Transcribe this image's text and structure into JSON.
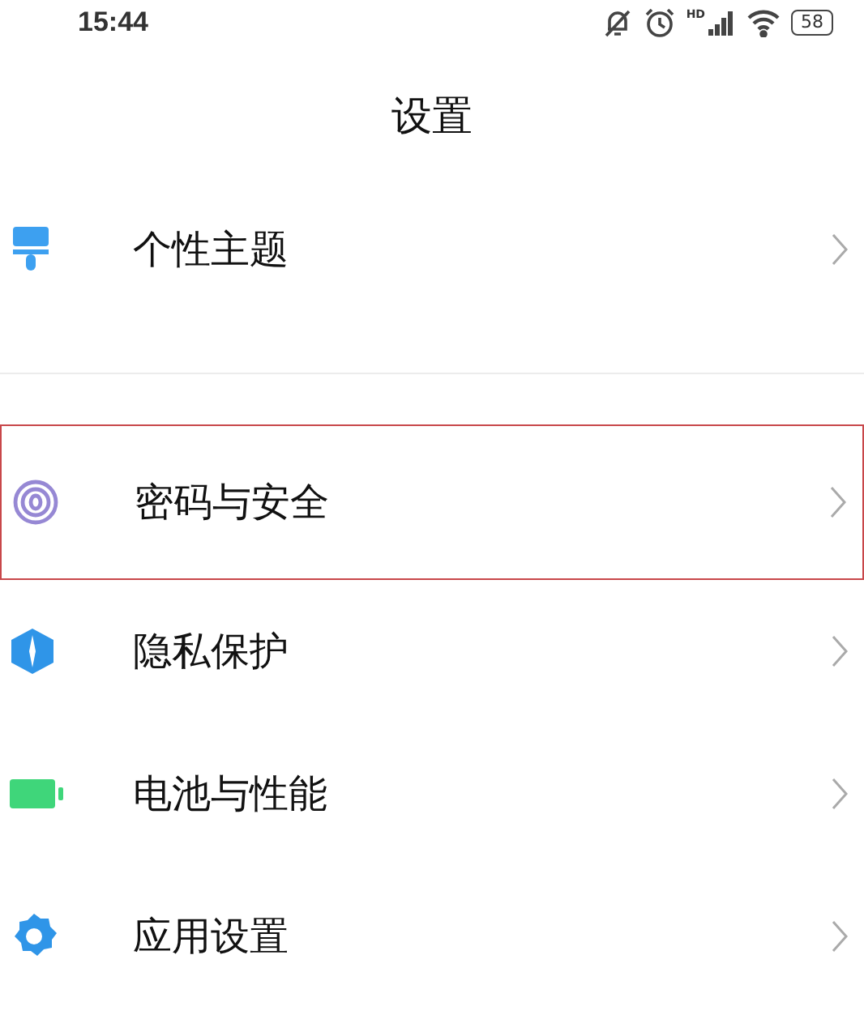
{
  "status_bar": {
    "time": "15:44",
    "signal_label": "HD",
    "battery": "58"
  },
  "title": "设置",
  "groups": [
    {
      "items": [
        {
          "kind": "theme",
          "label": "个性主题",
          "selected": false
        }
      ]
    },
    {
      "items": [
        {
          "kind": "password",
          "label": "密码与安全",
          "selected": true
        },
        {
          "kind": "privacy",
          "label": "隐私保护",
          "selected": false
        },
        {
          "kind": "battery",
          "label": "电池与性能",
          "selected": false
        },
        {
          "kind": "apps",
          "label": "应用设置",
          "selected": false
        }
      ]
    }
  ]
}
